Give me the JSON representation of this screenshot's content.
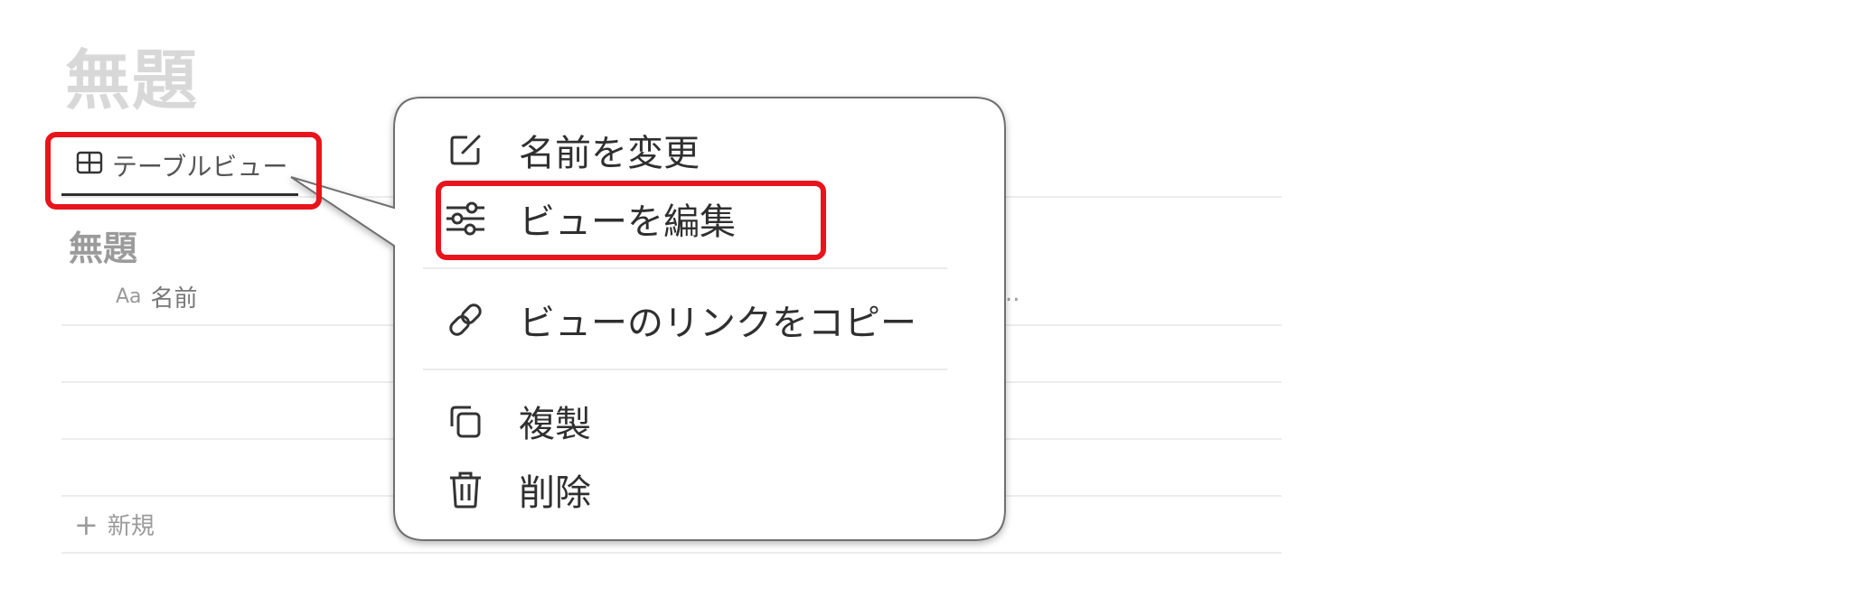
{
  "page": {
    "title": "無題"
  },
  "view_tab": {
    "icon": "table-icon",
    "label": "テーブルビュー"
  },
  "database": {
    "title": "無題",
    "columns": [
      {
        "type_label": "Aa",
        "name": "名前"
      }
    ],
    "more_indicator": "..",
    "rows": [
      "",
      "",
      ""
    ],
    "new_row_label": "新規"
  },
  "context_menu": {
    "items": [
      {
        "icon": "edit-icon",
        "label": "名前を変更"
      },
      {
        "icon": "sliders-icon",
        "label": "ビューを編集"
      },
      {
        "icon": "link-icon",
        "label": "ビューのリンクをコピー"
      },
      {
        "icon": "duplicate-icon",
        "label": "複製"
      },
      {
        "icon": "trash-icon",
        "label": "削除"
      }
    ]
  },
  "annotation": {
    "highlight_color": "#e8141b"
  }
}
